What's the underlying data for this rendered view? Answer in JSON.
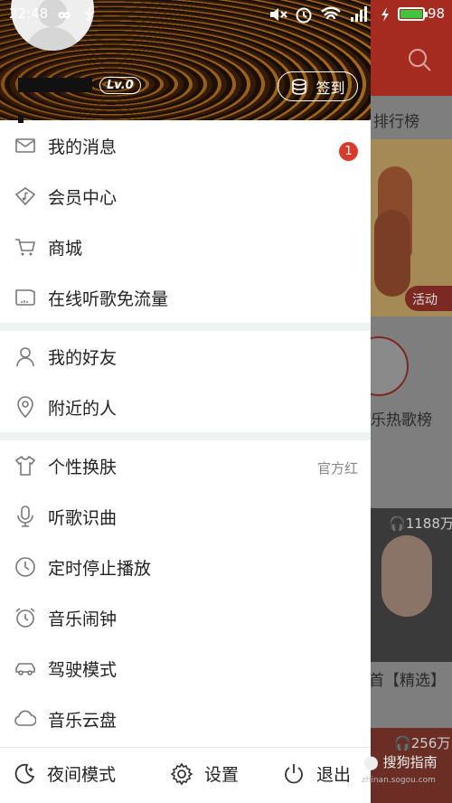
{
  "status_bar": {
    "time": "22:48",
    "battery": "98",
    "network": "4G"
  },
  "drawer": {
    "level": "Lv.0",
    "signin_label": "签到",
    "groups": [
      [
        {
          "label": "我的消息",
          "icon": "mail-icon",
          "badge": "1"
        },
        {
          "label": "会员中心",
          "icon": "diamond-music-icon"
        },
        {
          "label": "商城",
          "icon": "cart-icon"
        },
        {
          "label": "在线听歌免流量",
          "icon": "sim-card-icon"
        }
      ],
      [
        {
          "label": "我的好友",
          "icon": "person-icon"
        },
        {
          "label": "附近的人",
          "icon": "location-pin-icon"
        }
      ],
      [
        {
          "label": "个性换肤",
          "icon": "tshirt-icon",
          "extra": "官方红"
        },
        {
          "label": "听歌识曲",
          "icon": "microphone-icon"
        },
        {
          "label": "定时停止播放",
          "icon": "clock-icon"
        },
        {
          "label": "音乐闹钟",
          "icon": "alarm-clock-icon"
        },
        {
          "label": "驾驶模式",
          "icon": "car-icon"
        },
        {
          "label": "音乐云盘",
          "icon": "cloud-icon"
        }
      ]
    ],
    "footer": {
      "night_mode": "夜间模式",
      "settings": "设置",
      "logout": "退出"
    }
  },
  "background": {
    "ranking_label": "排行榜",
    "activity_label": "活动",
    "hot_chart_label": "乐热歌榜",
    "play_count_1": "1188万",
    "playlist_label": "首【精选】",
    "play_count_2": "256万"
  },
  "watermark": {
    "text": "搜狗指南",
    "url": "zhinan.sogou.com"
  },
  "colors": {
    "accent_red": "#d93a2e",
    "toggle_green": "#3ec43e"
  }
}
